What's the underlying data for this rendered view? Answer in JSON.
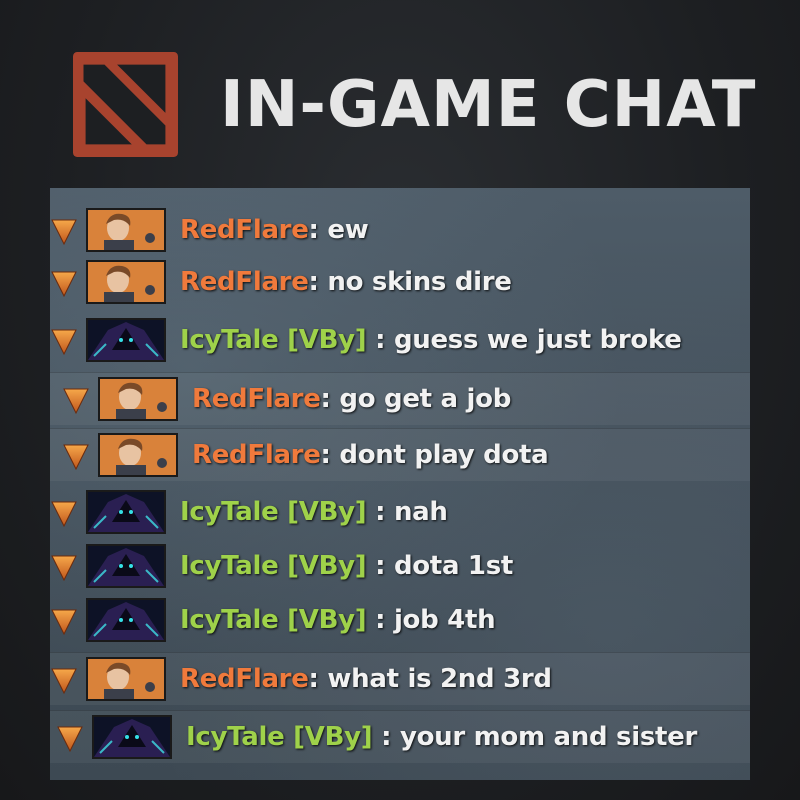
{
  "header": {
    "title": "IN-GAME CHAT",
    "logo_icon": "dota-logo-icon",
    "logo_color": "#a8432e"
  },
  "colors": {
    "radiant_name": "#9fd24a",
    "dire_name": "#f07a3c",
    "message_text": "#f2f2f2"
  },
  "chat": {
    "messages": [
      {
        "player": "RedFlare",
        "separator": ": ",
        "text": "ew",
        "team": "dire",
        "hero_icon": "hero-portrait-boy-icon"
      },
      {
        "player": "RedFlare",
        "separator": ": ",
        "text": "no skins dire",
        "team": "dire",
        "hero_icon": "hero-portrait-boy-icon"
      },
      {
        "player": "IcyTale [VBy]",
        "separator": " : ",
        "text": "guess we just broke",
        "team": "radiant",
        "hero_icon": "hero-portrait-spectre-icon"
      },
      {
        "player": "RedFlare",
        "separator": ": ",
        "text": "go get a job",
        "team": "dire",
        "hero_icon": "hero-portrait-boy-icon"
      },
      {
        "player": "RedFlare",
        "separator": ": ",
        "text": "dont play dota",
        "team": "dire",
        "hero_icon": "hero-portrait-boy-icon"
      },
      {
        "player": "IcyTale [VBy]",
        "separator": " : ",
        "text": "nah",
        "team": "radiant",
        "hero_icon": "hero-portrait-spectre-icon"
      },
      {
        "player": "IcyTale [VBy]",
        "separator": " : ",
        "text": "dota 1st",
        "team": "radiant",
        "hero_icon": "hero-portrait-spectre-icon"
      },
      {
        "player": "IcyTale [VBy]",
        "separator": " : ",
        "text": "job 4th",
        "team": "radiant",
        "hero_icon": "hero-portrait-spectre-icon"
      },
      {
        "player": "RedFlare",
        "separator": ": ",
        "text": "what is 2nd 3rd",
        "team": "dire",
        "hero_icon": "hero-portrait-boy-icon"
      },
      {
        "player": "IcyTale [VBy]",
        "separator": " : ",
        "text": "your mom and sister",
        "team": "radiant",
        "hero_icon": "hero-portrait-spectre-icon"
      }
    ]
  }
}
